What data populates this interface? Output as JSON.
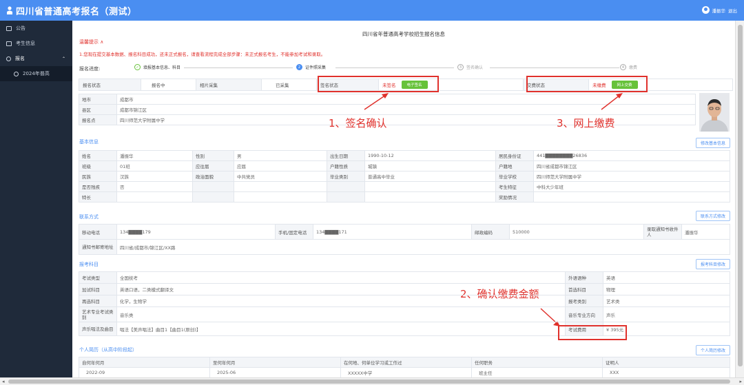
{
  "app": {
    "title": "四川省普通高考报名（测试）"
  },
  "user": {
    "name": "潘振华",
    "logout": "退出"
  },
  "sidebar": {
    "items": [
      {
        "label": "公告",
        "icon": "home-icon"
      },
      {
        "label": "考生信息",
        "icon": "id-card-icon"
      },
      {
        "label": "报名",
        "icon": "link-icon",
        "expanded": true
      },
      {
        "label": "2024年普高",
        "icon": "circle-icon"
      }
    ]
  },
  "page": {
    "title": "四川省年普通高考学校招生报名信息",
    "reminder": "温馨提示 ∧",
    "notice": "1.您现在提交基本数据、报名科目成功，还未正式报名，请查看流程完成全部步骤：未正式报名考生，不能参加考试和录取。"
  },
  "progress": {
    "label": "报名进度:",
    "steps": [
      {
        "num": "✓",
        "label": "填报基本信息、科目",
        "state": "done"
      },
      {
        "num": "2",
        "label": "证件照采集",
        "state": "active"
      },
      {
        "num": "3",
        "label": "签名确认",
        "state": "pending"
      },
      {
        "num": "4",
        "label": "缴费",
        "state": "pending"
      }
    ]
  },
  "status": {
    "enroll_label": "报名状态",
    "enroll_value": "报名中",
    "photo_label": "相片采集",
    "photo_value": "已采集",
    "sign_label": "签名状态",
    "sign_value": "未签名",
    "sign_button": "电子签名",
    "fee_label": "交费状态",
    "fee_value": "未缴费",
    "fee_button": "网上交费"
  },
  "site": {
    "city_label": "地市",
    "city_value": "成都市",
    "county_label": "县区",
    "county_value": "成都市锦江区",
    "point_label": "报名点",
    "point_value": "四川师范大学附属中学"
  },
  "basic": {
    "title": "基本信息",
    "button": "修改基本信息",
    "rows": [
      [
        "姓名",
        "潘振华",
        "性别",
        "男",
        "出生日期",
        "1990-10-12",
        "居民身份证",
        "441▇▇▇▇▇▇▇▇26836"
      ],
      [
        "班级",
        "01班",
        "应往届",
        "应届",
        "户籍性质",
        "城镇",
        "户籍地",
        "四川省成都市锦江区"
      ],
      [
        "民族",
        "汉族",
        "政治面貌",
        "中共党员",
        "毕业类别",
        "普通高中毕业",
        "毕业学校",
        "四川师范大学附属中学"
      ],
      [
        "是否残疾",
        "否",
        "",
        "",
        "",
        "",
        "考生特征",
        "中科大少年班"
      ],
      [
        "特长",
        "",
        "",
        "",
        "",
        "",
        "奖励情况",
        ""
      ]
    ]
  },
  "contact": {
    "title": "联系方式",
    "button": "联系方式修改",
    "mobile_label": "移动电话",
    "mobile_value": "134▇▇▇▇179",
    "phone_label": "手机/固定电话",
    "phone_value": "134▇▇▇▇171",
    "zip_label": "邮政编码",
    "zip_value": "510000",
    "receiver_label": "录取通知书收件人",
    "receiver_value": "潘振华",
    "address_label": "通知书邮寄地址",
    "address_value": "四川省/成都市/锦江区/XX路"
  },
  "subjects": {
    "title": "报考科目",
    "button": "报考科目修改",
    "exam_type_label": "考试类型",
    "exam_type_value": "全国统考",
    "foreign_label": "外语语种",
    "foreign_value": "英语",
    "extra_label": "加试科目",
    "extra_value": "英语口语，二类模式翻译文",
    "first_label": "首选科目",
    "first_value": "物理",
    "second_label": "再选科目",
    "second_value": "化学，生物学",
    "category_label": "报考类别",
    "category_value": "艺术类",
    "art_label": "艺术专业考试类别",
    "art_value": "音乐类",
    "music_dir_label": "音乐专业方向",
    "music_dir_value": "声乐",
    "vocal_label": "声乐唱法及曲目",
    "vocal_value": "唱法【美声唱法】曲目1【曲目1(原创)】",
    "fee_label": "考试费用",
    "fee_value": "¥ 395元"
  },
  "resume": {
    "title": "个人简历（从高中阶段起）",
    "button": "个人简历修改",
    "headers": [
      "自何年何月",
      "至何年何月",
      "在何地、何单位学习或工作过",
      "任何职务",
      "证明人"
    ],
    "rows": [
      [
        "2022-09",
        "2025-06",
        "XXXXX中学",
        "班主任",
        "XXX"
      ]
    ]
  },
  "annotations": {
    "a1": "1、签名确认",
    "a2": "2、确认缴费金额",
    "a3": "3、网上缴费",
    "color": "#e0312c"
  },
  "colors": {
    "header": "#4a8ef1",
    "sidebar": "#1f2a3a",
    "accent": "#e0312c",
    "button_green": "#67c23a"
  }
}
